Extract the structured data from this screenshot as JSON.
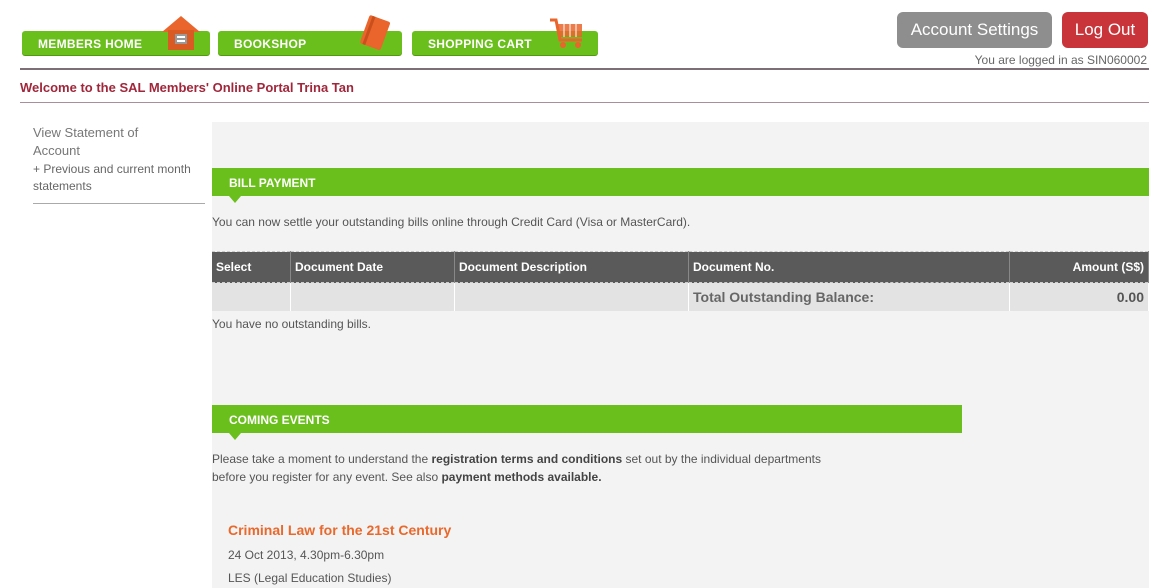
{
  "nav": {
    "tabs": [
      {
        "label": "MEMBERS HOME",
        "icon": "house-icon"
      },
      {
        "label": "BOOKSHOP",
        "icon": "book-icon"
      },
      {
        "label": "SHOPPING CART",
        "icon": "cart-icon"
      }
    ],
    "account_settings": "Account Settings",
    "log_out": "Log Out",
    "logged_in_text": "You are logged in as SIN060002"
  },
  "welcome": "Welcome to the SAL Members' Online Portal Trina Tan",
  "sidebar": {
    "title": "View Statement of Account",
    "sub_item": "+ Previous and current month statements"
  },
  "bill_payment": {
    "heading": "BILL PAYMENT",
    "intro": "You can now settle your outstanding bills online through Credit Card (Visa or MasterCard).",
    "columns": [
      "Select",
      "Document Date",
      "Document Description",
      "Document No.",
      "Amount (S$)"
    ],
    "total_label": "Total Outstanding Balance:",
    "total_value": "0.00",
    "note": "You have no outstanding bills."
  },
  "coming_events": {
    "heading": "COMING EVENTS",
    "line1_pre": "Please take a moment to understand the ",
    "line1_bold": "registration terms and conditions",
    "line1_post": " set out by the individual departments",
    "line2_pre": "before you register for any event. See also ",
    "line2_bold": "payment methods available.",
    "event": {
      "title": "Criminal Law for the 21st Century",
      "date": "24 Oct 2013, 4.30pm-6.30pm",
      "org": "LES (Legal Education Studies)"
    }
  },
  "colors": {
    "green": "#6bbf1d",
    "logout": "#c9343b",
    "welcome": "#a0273b",
    "event_title": "#e9682b"
  }
}
